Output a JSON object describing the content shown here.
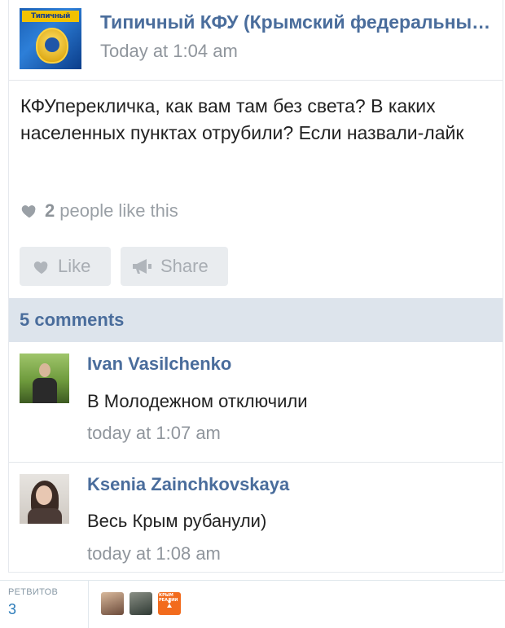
{
  "post": {
    "group_name": "Типичный КФУ (Крымский федеральный университет)",
    "avatar_text": "Типичный",
    "timestamp": "Today at 1:04 am",
    "text": "КФУперекличка, как вам там без света? В каких населенных пунктах отрубили? Если назвали-лайк",
    "likes_count": "2",
    "likes_suffix": "people like this",
    "like_label": "Like",
    "share_label": "Share"
  },
  "comments_header": "5 comments",
  "comments": [
    {
      "author": "Ivan Vasilchenko",
      "text": "В Молодежном отключили",
      "time": "today at 1:07 am"
    },
    {
      "author": "Ksenia Zainchkovskaya",
      "text": "Весь Крым рубанули)",
      "time": "today at 1:08 am"
    }
  ],
  "retweets": {
    "label": "РЕТВИТОВ",
    "count": "3",
    "badge_text": "КРЫМ РЕАЛИИ"
  },
  "colors": {
    "link_blue": "#4a6d9c",
    "comments_bar_bg": "#dde4ec",
    "button_bg": "#e9ecef",
    "retweet_count": "#2b7bb9",
    "badge_orange": "#f26b1d"
  },
  "icons": [
    "heart-icon",
    "like-heart-icon",
    "megaphone-icon"
  ]
}
